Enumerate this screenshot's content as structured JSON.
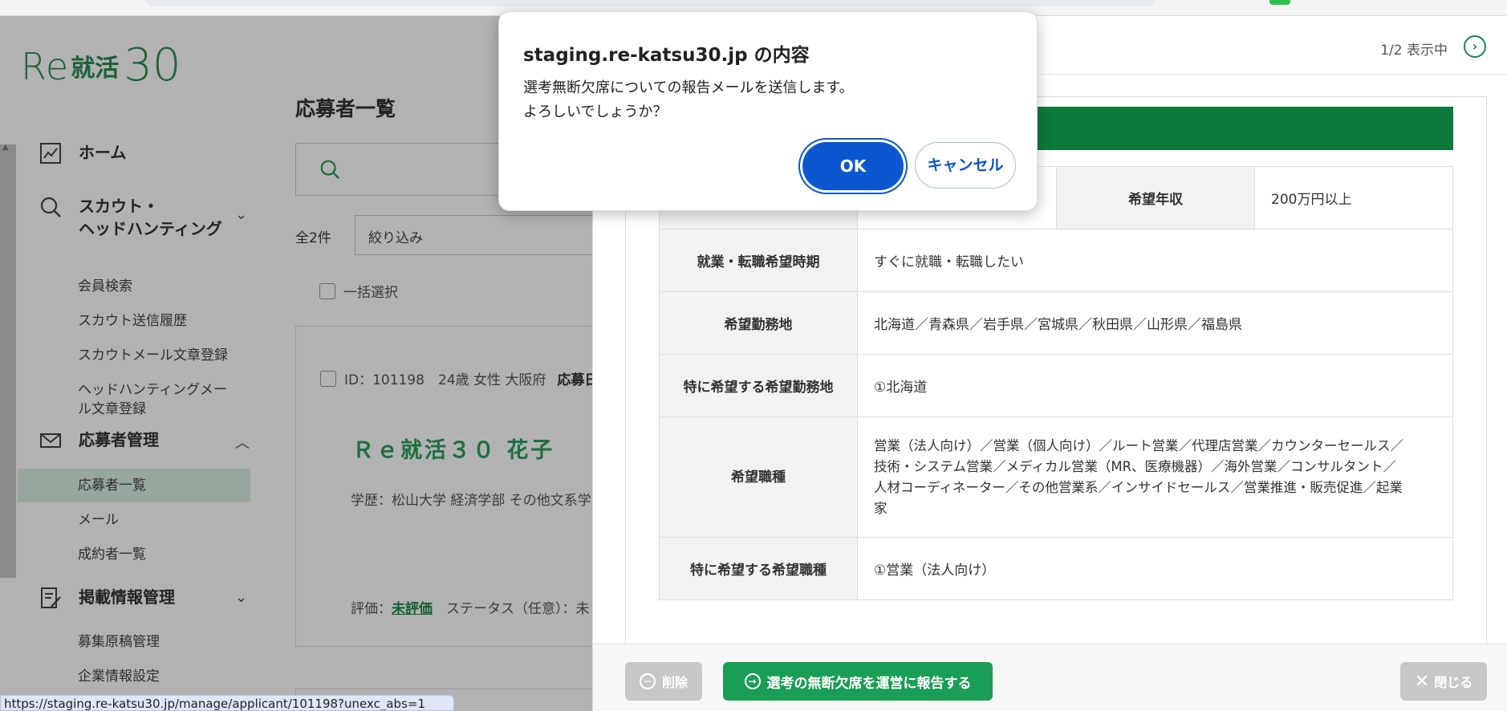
{
  "sidebar": {
    "logo": {
      "re": "Re",
      "katsu": "就活",
      "num": "30"
    },
    "home": "ホーム",
    "scout": {
      "label_line1": "スカウト・",
      "label_line2": "ヘッドハンティング",
      "items": [
        "会員検索",
        "スカウト送信履歴",
        "スカウトメール文章登録"
      ],
      "hh_line1": "ヘッドハンティングメー",
      "hh_line2": "ル文章登録"
    },
    "applicants": {
      "label": "応募者管理",
      "items": [
        "応募者一覧",
        "メール",
        "成約者一覧"
      ]
    },
    "listing": {
      "label": "掲載情報管理",
      "items": [
        "募集原稿管理",
        "企業情報設定"
      ]
    }
  },
  "main": {
    "title": "応募者一覧",
    "search_placeholder": "",
    "count": "全2件",
    "filter": "絞り込み",
    "bulk_select": "一括選択",
    "card": {
      "id_info": "ID：101198　24歳 女性 大阪府",
      "strong": "応募日",
      "name": "Ｒｅ就活３０ 花子",
      "education": "学歴：松山大学 経済学部 その他文系学",
      "eval_label": "評価：",
      "eval_value": "未評価",
      "status_label": "ステータス（任意）：",
      "status_value": "未"
    }
  },
  "panel": {
    "pager": "1/2 表示中",
    "pager_next": "›",
    "rows": [
      {
        "label": "",
        "value": "",
        "label2": "希望年収",
        "value2": "200万円以上"
      },
      {
        "label": "就業・転職希望時期",
        "value": "すぐに就職・転職したい"
      },
      {
        "label": "希望勤務地",
        "value": "北海道／青森県／岩手県／宮城県／秋田県／山形県／福島県"
      },
      {
        "label": "特に希望する希望勤務地",
        "value": "①北海道"
      },
      {
        "label": "希望職種",
        "value_l1": "営業（法人向け）／営業（個人向け）／ルート営業／代理店営業／カウンターセールス／",
        "value_l2": "技術・システム営業／メディカル営業（MR、医療機器）／海外営業／コンサルタント／",
        "value_l3": "人材コーディネーター／その他営業系／インサイドセールス／営業推進・販売促進／起業",
        "value_l4": "家"
      },
      {
        "label": "特に希望する希望職種",
        "value": "①営業（法人向け）"
      }
    ],
    "footer": {
      "delete": "削除",
      "report": "選考の無断欠席を運営に報告する",
      "close": "閉じる"
    }
  },
  "dialog": {
    "title": "staging.re-katsu30.jp の内容",
    "message_line1": "選考無断欠席についての報告メールを送信します。",
    "message_line2": "よろしいでしょうか？",
    "ok": "OK",
    "cancel": "キャンセル"
  },
  "status_bar_url": "https://staging.re-katsu30.jp/manage/applicant/101198?unexc_abs=1",
  "colors": {
    "brand_green": "#1a9e55",
    "header_green": "#0b7a3b",
    "dialog_blue": "#0b57d0"
  }
}
